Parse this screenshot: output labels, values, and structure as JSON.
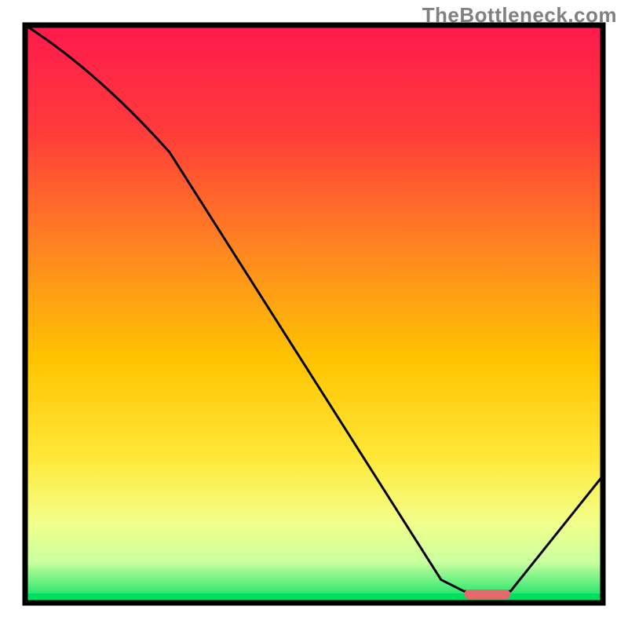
{
  "watermark": "TheBottleneck.com",
  "colors": {
    "frame": "#000000",
    "plot_background_top": "#ff1a4d",
    "plot_background_mid": "#ffd000",
    "plot_background_low": "#f5ff7a",
    "plot_background_bottom": "#00e060",
    "curve": "#000000",
    "marker": "#e46a6e"
  },
  "chart_data": {
    "type": "line",
    "title": "",
    "xlabel": "",
    "ylabel": "",
    "xlim": [
      0,
      100
    ],
    "ylim": [
      0,
      100
    ],
    "x": [
      0,
      25,
      72,
      76,
      84,
      100
    ],
    "values": [
      100,
      78,
      4,
      2,
      2,
      22
    ],
    "marker": {
      "x_start": 76,
      "x_end": 84,
      "y": 1.5
    },
    "annotations": []
  }
}
